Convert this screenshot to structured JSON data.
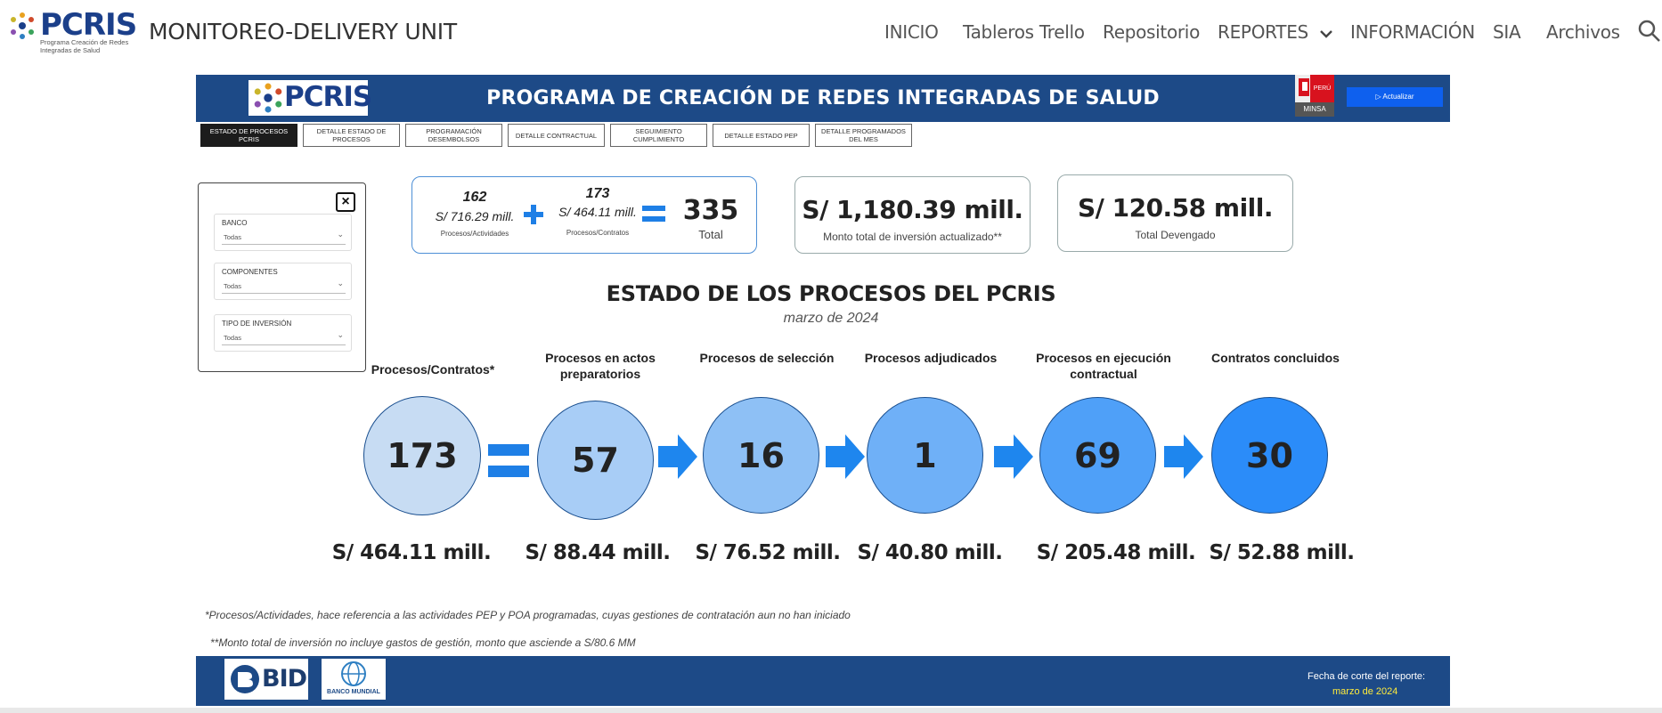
{
  "nav": {
    "logo_text": "PCRIS",
    "logo_sub": "Programa Creación de Redes Integradas de Salud",
    "site_title": "MONITOREO-DELIVERY UNIT",
    "items": [
      "INICIO",
      "Tableros Trello",
      "Repositorio",
      "REPORTES",
      "INFORMACIÓN",
      "SIA",
      "Archivos"
    ]
  },
  "banner": {
    "logo_text": "PCRIS",
    "title": "PROGRAMA DE CREACIÓN DE REDES INTEGRADAS DE SALUD",
    "peru_label": "PERÚ",
    "minsa_label": "MINSA",
    "refresh_button": "Actualizar"
  },
  "tabs": [
    "ESTADO DE PROCESOS PCRIS",
    "DETALLE ESTADO DE PROCESOS",
    "PROGRAMACIÓN DESEMBOLSOS",
    "DETALLE CONTRACTUAL",
    "SEGUIMIENTO CUMPLIMIENTO",
    "DETALLE ESTADO PEP",
    "DETALLE PROGRAMADOS DEL MES"
  ],
  "filters": [
    {
      "label": "BANCO",
      "value": "Todas"
    },
    {
      "label": "COMPONENTES",
      "value": "Todas"
    },
    {
      "label": "TIPO DE INVERSIÓN",
      "value": "Todas"
    }
  ],
  "kpi_sum": {
    "left_count": "162",
    "left_amount": "S/ 716.29 mill.",
    "left_label": "Procesos/Actividades",
    "right_count": "173",
    "right_amount": "S/ 464.11 mill.",
    "right_label": "Procesos/Contratos",
    "total": "335",
    "total_label": "Total"
  },
  "kpi_investment": {
    "value": "S/ 1,180.39 mill.",
    "label": "Monto total de inversión actualizado**"
  },
  "kpi_devengado": {
    "value": "S/ 120.58 mill.",
    "label": "Total Devengado"
  },
  "section": {
    "title": "ESTADO DE LOS PROCESOS DEL PCRIS",
    "subtitle": "marzo de 2024"
  },
  "stages": [
    {
      "label": "Procesos/Contratos*",
      "count": "173",
      "amount": "S/ 464.11 mill.",
      "color": "#c7dcf3"
    },
    {
      "label": "Procesos en actos preparatorios",
      "count": "57",
      "amount": "S/ 88.44 mill.",
      "color": "#a8cdf6"
    },
    {
      "label": "Procesos de selección",
      "count": "16",
      "amount": "S/ 76.52 mill.",
      "color": "#8ec0f5"
    },
    {
      "label": "Procesos adjudicados",
      "count": "1",
      "amount": "S/ 40.80 mill.",
      "color": "#6fb0f7"
    },
    {
      "label": "Procesos en ejecución contractual",
      "count": "69",
      "amount": "S/ 205.48 mill.",
      "color": "#4fa0f8"
    },
    {
      "label": "Contratos concluidos",
      "count": "30",
      "amount": "S/ 52.88 mill.",
      "color": "#2b8cf9"
    }
  ],
  "notes": [
    "*Procesos/Actividades, hace referencia a las actividades PEP y POA programadas, cuyas gestiones de contratación aun no han iniciado",
    "**Monto total de inversión no incluye gastos de gestión, monto que asciende a S/80.6 MM"
  ],
  "footer": {
    "bid_text": "BID",
    "bm_text": "BANCO MUNDIAL",
    "cutoff_label": "Fecha de corte del reporte:",
    "cutoff_date": "marzo de 2024"
  }
}
